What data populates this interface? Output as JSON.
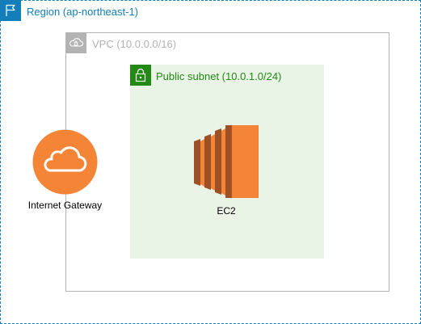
{
  "region": {
    "label": "Region (ap-northeast-1)",
    "icon": "flag-icon",
    "color": "#147EBA"
  },
  "vpc": {
    "label": "VPC (10.0.0.0/16)",
    "icon": "cloud-lock-icon",
    "color": "#B3B3B3"
  },
  "subnet": {
    "label": "Public subnet (10.0.1.0/24)",
    "icon": "padlock-icon",
    "color": "#248814",
    "fill": "#E9F3E6"
  },
  "internet_gateway": {
    "label": "Internet Gateway",
    "icon": "cloud-icon",
    "color": "#F58536"
  },
  "ec2": {
    "label": "EC2",
    "icon": "ec2-instance-icon",
    "color": "#F58536"
  }
}
